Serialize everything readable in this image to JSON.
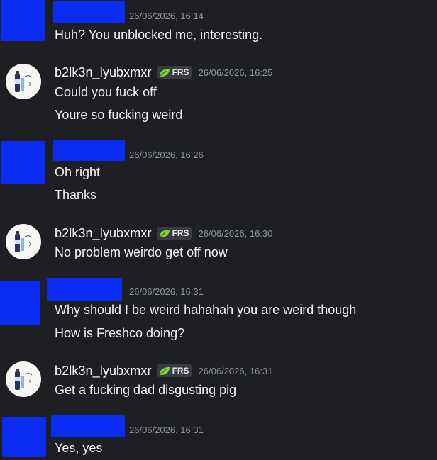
{
  "colors": {
    "background": "#1e1f22",
    "redaction": "#0a2cf2",
    "timestamp": "#8f939b",
    "tag_background": "#3a3b40",
    "leaf_green": "#7fd43a"
  },
  "tag": {
    "icon": "leaf-icon",
    "label": "FRS"
  },
  "messages": [
    {
      "author_redacted": true,
      "timestamp": "26/06/2026, 16:14",
      "lines": [
        "Huh? You unblocked me, interesting."
      ]
    },
    {
      "username": "b2lk3n_lyubxmxr",
      "timestamp": "26/06/2026, 16:25",
      "lines": [
        "Could you fuck off",
        "Youre so fucking weird"
      ]
    },
    {
      "author_redacted": true,
      "timestamp": "26/06/2026, 16:26",
      "lines": [
        "Oh right",
        "Thanks"
      ]
    },
    {
      "username": "b2lk3n_lyubxmxr",
      "timestamp": "26/06/2026, 16:30",
      "lines": [
        "No problem weirdo get off now"
      ]
    },
    {
      "author_redacted": true,
      "timestamp": "26/06/2026, 16:31",
      "lines": [
        "Why should I be weird hahahah you are weird though",
        "How is Freshco doing?"
      ]
    },
    {
      "username": "b2lk3n_lyubxmxr",
      "timestamp": "26/06/2026, 16:31",
      "lines": [
        "Get a fucking dad disgusting pig"
      ]
    },
    {
      "author_redacted": true,
      "timestamp": "26/06/2026, 16:31",
      "lines": [
        "Yes, yes"
      ]
    }
  ]
}
